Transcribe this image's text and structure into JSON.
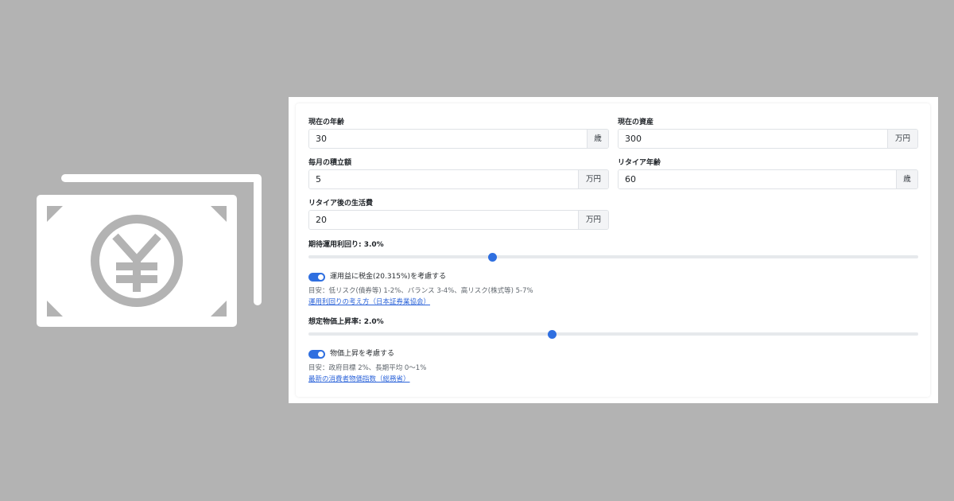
{
  "hero": {
    "icon": "yen-banknote-icon"
  },
  "form": {
    "current_age": {
      "label": "現在の年齢",
      "value": "30",
      "unit": "歳"
    },
    "current_assets": {
      "label": "現在の資産",
      "value": "300",
      "unit": "万円"
    },
    "monthly_saving": {
      "label": "毎月の積立額",
      "value": "5",
      "unit": "万円"
    },
    "retire_age": {
      "label": "リタイア年齢",
      "value": "60",
      "unit": "歳"
    },
    "living_cost": {
      "label": "リタイア後の生活費",
      "value": "20",
      "unit": "万円"
    }
  },
  "return_rate": {
    "label": "期待運用利回り: 3.0%",
    "value_fraction": 0.302,
    "tax_toggle": {
      "label": "運用益に税金(20.315%)を考慮する",
      "on": true
    },
    "hint": "目安：低リスク(債券等) 1-2%、バランス 3-4%、高リスク(株式等) 5-7%",
    "link": "運用利回りの考え方（日本証券業協会）"
  },
  "inflation": {
    "label": "想定物価上昇率: 2.0%",
    "value_fraction": 0.4,
    "toggle": {
      "label": "物価上昇を考慮する",
      "on": true
    },
    "hint": "目安：政府目標 2%、長期平均 0〜1%",
    "link": "最新の消費者物価指数（総務省）"
  },
  "colors": {
    "accent": "#2f6fe0",
    "link": "#2b63d9",
    "background": "#b3b3b3"
  }
}
